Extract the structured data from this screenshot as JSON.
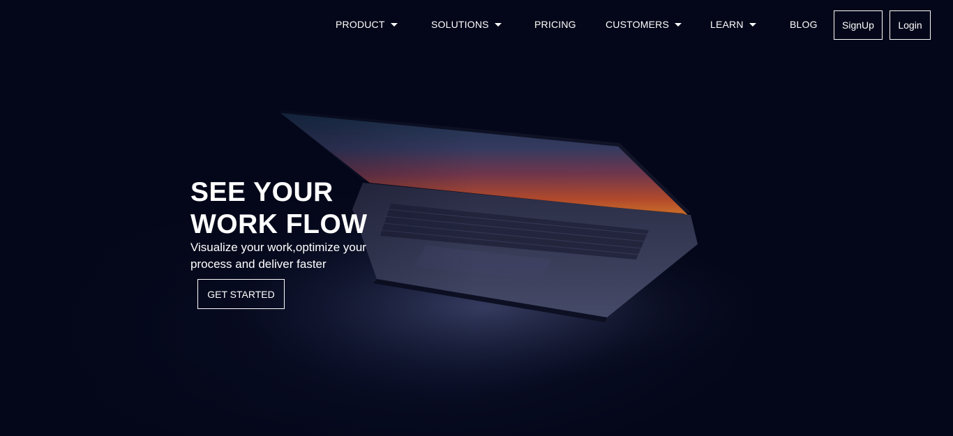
{
  "nav": {
    "items": [
      {
        "label": "PRODUCT",
        "has_dropdown": true
      },
      {
        "label": "SOLUTIONS",
        "has_dropdown": true
      },
      {
        "label": "PRICING",
        "has_dropdown": false
      },
      {
        "label": "CUSTOMERS",
        "has_dropdown": true
      },
      {
        "label": "LEARN",
        "has_dropdown": true
      },
      {
        "label": "BLOG",
        "has_dropdown": false
      }
    ],
    "signup_label": "SignUp",
    "login_label": "Login"
  },
  "hero": {
    "title_line1": "SEE YOUR",
    "title_line2": "WORK FLOW",
    "subtitle_line1": "Visualize your work,optimize your",
    "subtitle_line2": "process and deliver faster",
    "cta_label": "GET STARTED"
  },
  "colors": {
    "background": "#040719",
    "text": "#ffffff",
    "screen_glow_top": "#2a4a6a",
    "screen_glow_bottom": "#c2552a"
  },
  "icons": {
    "dropdown": "caret-down-icon",
    "hero_image": "laptop-illustration"
  }
}
